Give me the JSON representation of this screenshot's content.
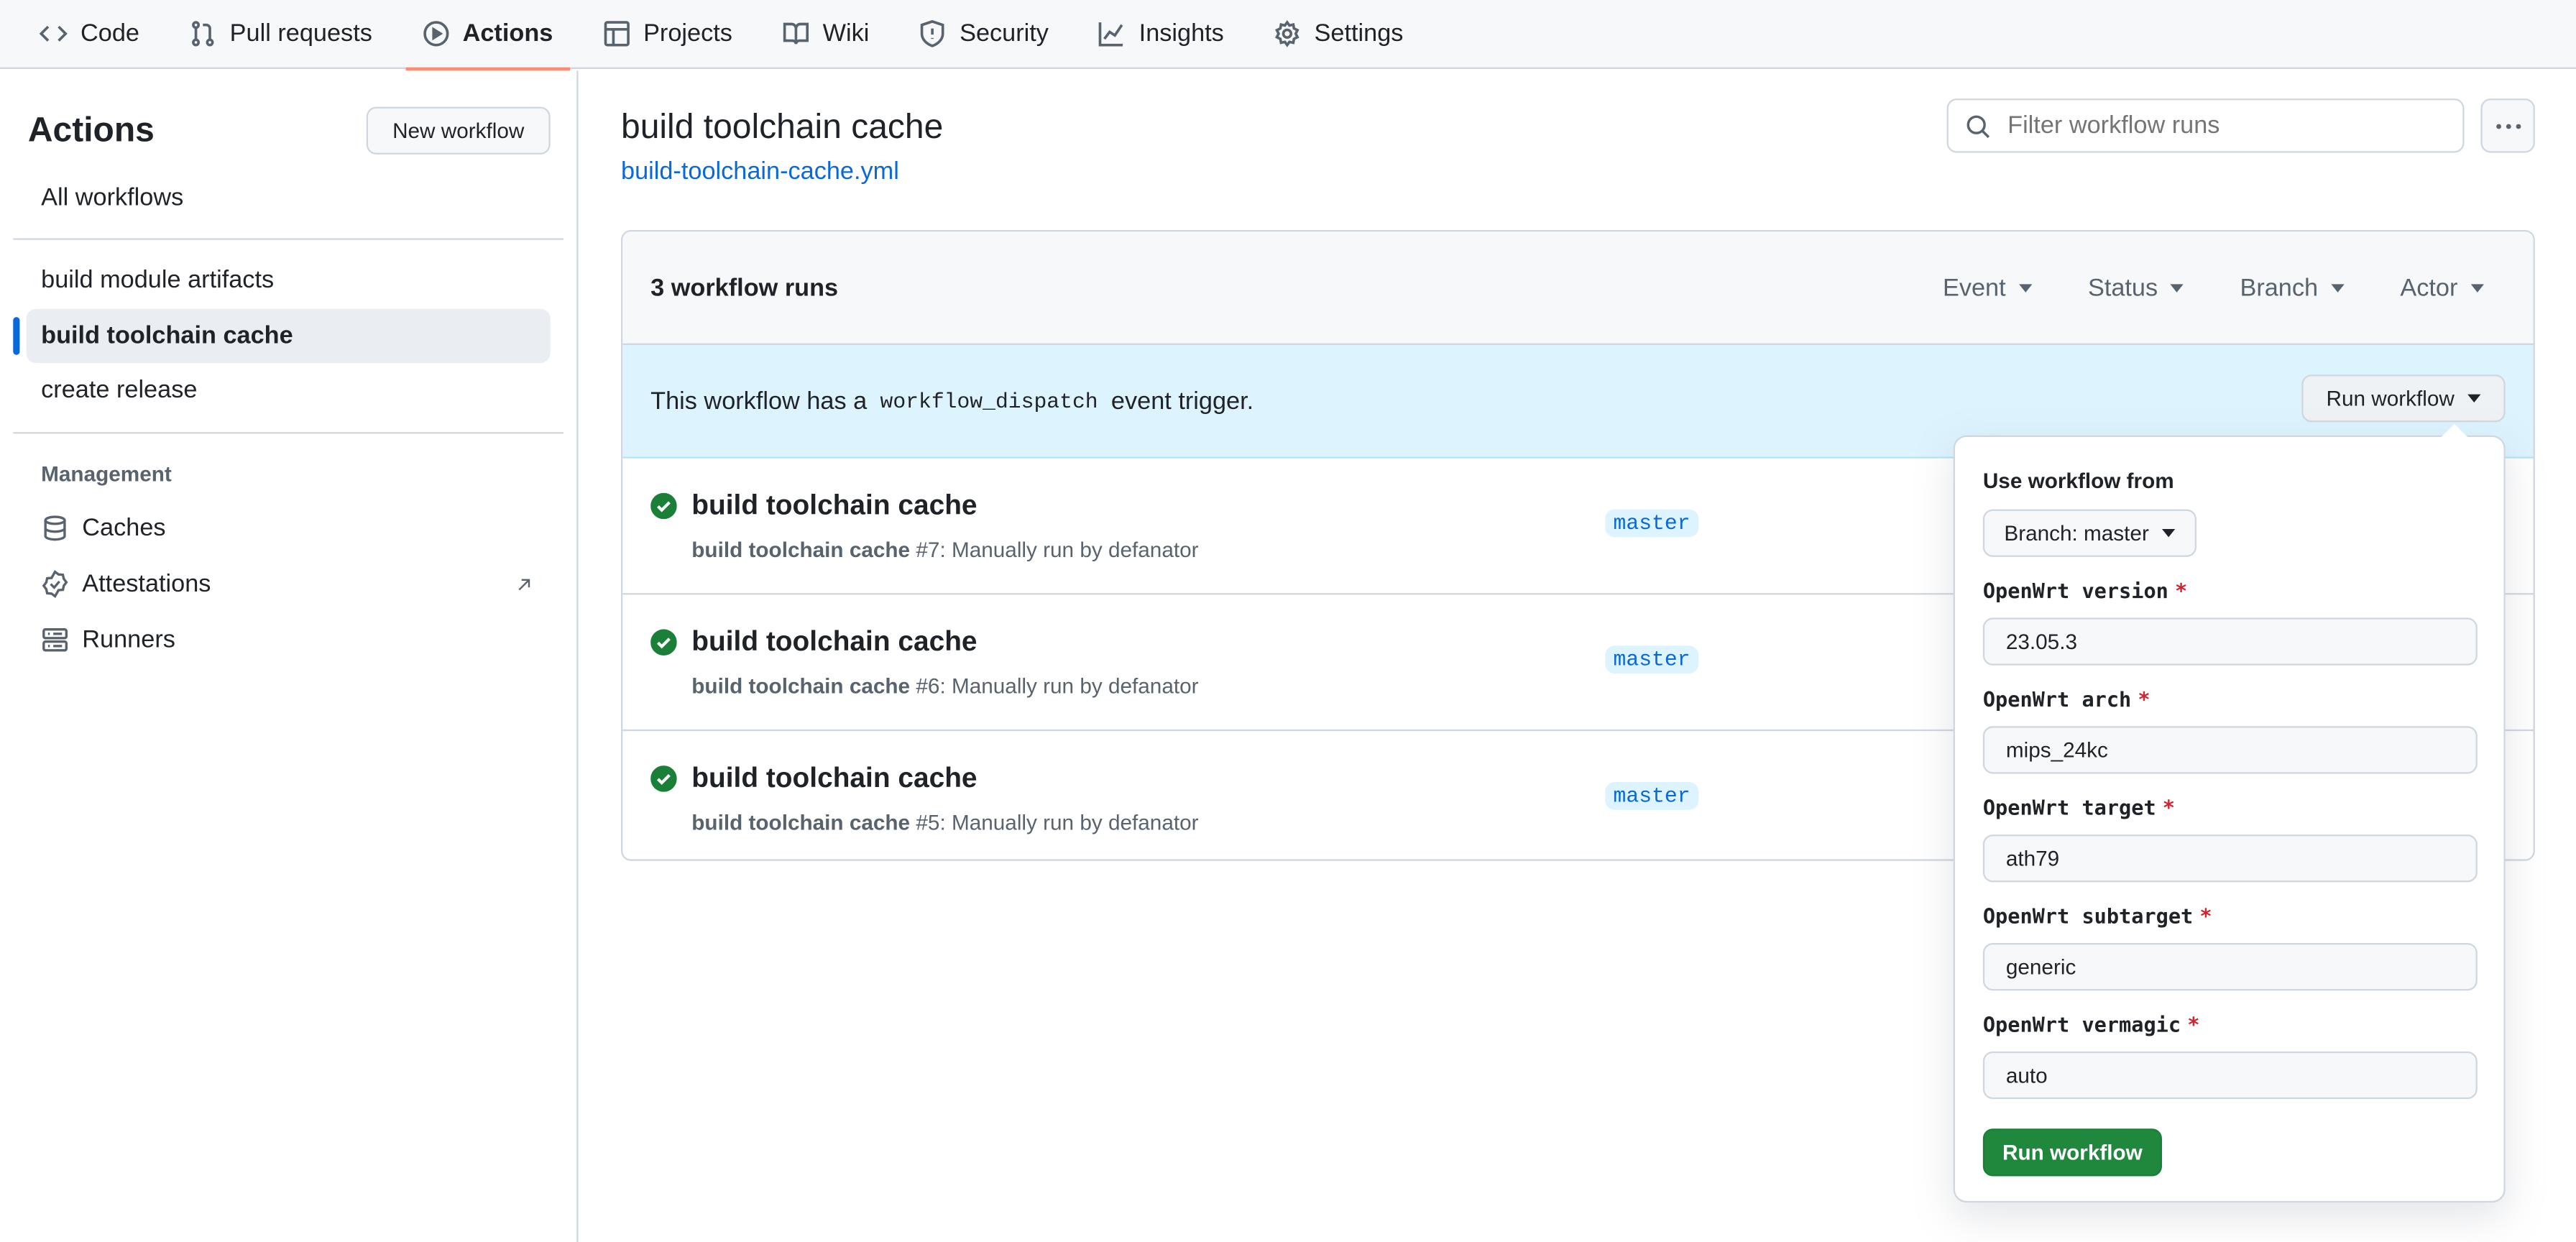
{
  "nav": {
    "tabs": [
      {
        "label": "Code",
        "icon": "code-icon"
      },
      {
        "label": "Pull requests",
        "icon": "pull-request-icon"
      },
      {
        "label": "Actions",
        "icon": "play-icon",
        "active": true
      },
      {
        "label": "Projects",
        "icon": "table-icon"
      },
      {
        "label": "Wiki",
        "icon": "book-icon"
      },
      {
        "label": "Security",
        "icon": "shield-icon"
      },
      {
        "label": "Insights",
        "icon": "graph-icon"
      },
      {
        "label": "Settings",
        "icon": "gear-icon"
      }
    ]
  },
  "sidebar": {
    "title": "Actions",
    "new_workflow": "New workflow",
    "all_workflows": "All workflows",
    "workflows": [
      "build module artifacts",
      "build toolchain cache",
      "create release"
    ],
    "selected": "build toolchain cache",
    "management_heading": "Management",
    "management": [
      {
        "label": "Caches",
        "icon": "database-icon"
      },
      {
        "label": "Attestations",
        "icon": "verified-icon",
        "external": true
      },
      {
        "label": "Runners",
        "icon": "server-icon"
      }
    ]
  },
  "main": {
    "title": "build toolchain cache",
    "file": "build-toolchain-cache.yml",
    "filter_placeholder": "Filter workflow runs",
    "runs_count": "3 workflow runs",
    "filters": [
      "Event",
      "Status",
      "Branch",
      "Actor"
    ],
    "banner": {
      "prefix": "This workflow has a",
      "code": "workflow_dispatch",
      "suffix": "event trigger.",
      "button": "Run workflow"
    },
    "runs": [
      {
        "title": "build toolchain cache",
        "name": "build toolchain cache",
        "num": "#7",
        "desc": ": Manually run by defanator",
        "branch": "master",
        "status": "success"
      },
      {
        "title": "build toolchain cache",
        "name": "build toolchain cache",
        "num": "#6",
        "desc": ": Manually run by defanator",
        "branch": "master",
        "status": "success"
      },
      {
        "title": "build toolchain cache",
        "name": "build toolchain cache",
        "num": "#5",
        "desc": ": Manually run by defanator",
        "branch": "master",
        "status": "success"
      }
    ]
  },
  "popup": {
    "use_from": "Use workflow from",
    "branch": "Branch: master",
    "fields": [
      {
        "label": "OpenWrt version",
        "value": "23.05.3",
        "required": "*"
      },
      {
        "label": "OpenWrt arch",
        "value": "mips_24kc",
        "required": "*"
      },
      {
        "label": "OpenWrt target",
        "value": "ath79",
        "required": "*"
      },
      {
        "label": "OpenWrt subtarget",
        "value": "generic",
        "required": "*"
      },
      {
        "label": "OpenWrt vermagic",
        "value": "auto",
        "required": "*"
      }
    ],
    "submit": "Run workflow"
  },
  "colors": {
    "accent": "#0969da",
    "success": "#1f883d",
    "tab_underline": "#fd8c73",
    "banner": "#ddf4ff",
    "required": "#d1242f"
  }
}
